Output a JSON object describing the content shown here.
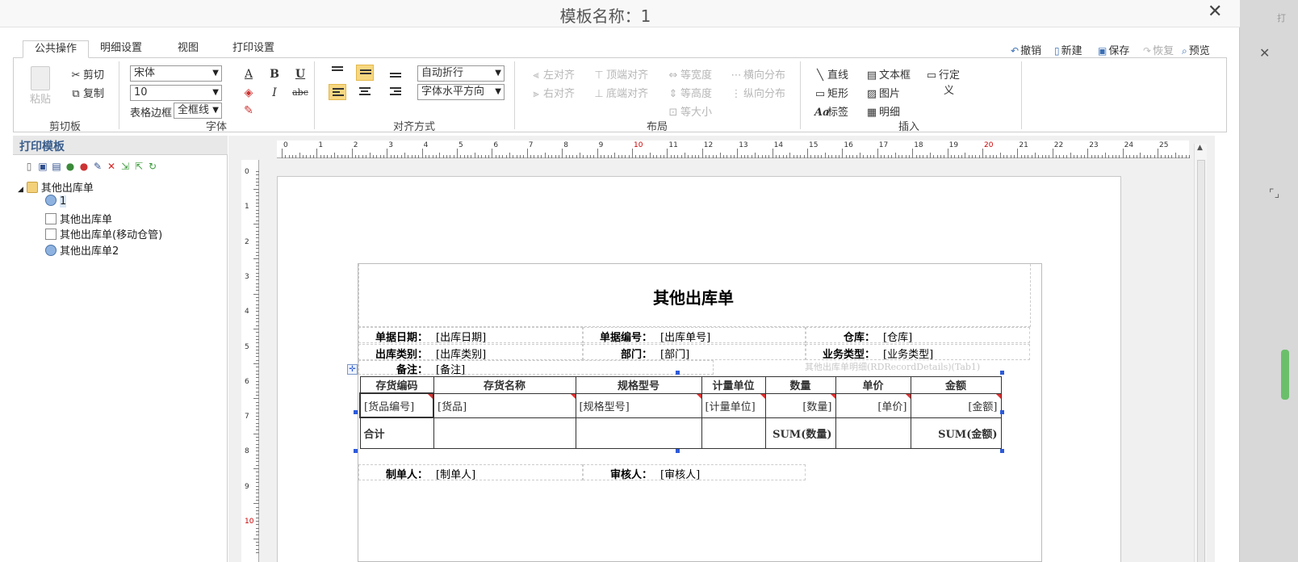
{
  "window": {
    "title": "模板名称：1",
    "close": "✕"
  },
  "tabs": [
    {
      "label": "公共操作",
      "active": true
    },
    {
      "label": "明细设置",
      "active": false
    },
    {
      "label": "视图",
      "active": false
    },
    {
      "label": "打印设置",
      "active": false
    }
  ],
  "quick_actions": {
    "undo": "撤销",
    "new": "新建",
    "save": "保存",
    "redo": "恢复",
    "preview": "预览"
  },
  "ribbon": {
    "clipboard": {
      "group": "剪切板",
      "paste": "粘贴",
      "cut": "剪切",
      "copy": "复制"
    },
    "font": {
      "group": "字体",
      "family": "宋体",
      "size": "10",
      "border_label": "表格边框",
      "border_value": "全框线",
      "bold": "B",
      "italic": "I",
      "underline": "U",
      "strike": "abc"
    },
    "align": {
      "group": "对齐方式",
      "wrap": "自动折行",
      "direction": "字体水平方向"
    },
    "layout": {
      "group": "布局",
      "left": "左对齐",
      "right": "右对齐",
      "top": "顶端对齐",
      "bottom": "底端对齐",
      "same_width": "等宽度",
      "same_height": "等高度",
      "same_size": "等大小",
      "h_dist": "横向分布",
      "v_dist": "纵向分布"
    },
    "insert": {
      "group": "插入",
      "line": "直线",
      "rect": "矩形",
      "label": "标签",
      "textbox": "文本框",
      "image": "图片",
      "detail": "明细",
      "custom_line": "行定",
      "custom_line_2": "义"
    }
  },
  "left_panel": {
    "title": "打印模板",
    "tree": {
      "root": "其他出库单",
      "selected": "1",
      "items": [
        "其他出库单",
        "其他出库单(移动仓管)",
        "其他出库单2"
      ]
    }
  },
  "ruler": {
    "top": [
      "0",
      "1",
      "2",
      "3",
      "4",
      "5",
      "6",
      "7",
      "8",
      "9",
      "10",
      "11",
      "12",
      "13",
      "14",
      "15",
      "16",
      "17",
      "18",
      "19",
      "20",
      "21",
      "22",
      "23",
      "24",
      "25"
    ],
    "left": [
      "0",
      "1",
      "2",
      "3",
      "4",
      "5",
      "6",
      "7",
      "8",
      "9",
      "10"
    ]
  },
  "report": {
    "title": "其他出库单",
    "fields": {
      "date_label": "单据日期：",
      "date_value": "[出库日期]",
      "no_label": "单据编号：",
      "no_value": "[出库单号]",
      "wh_label": "仓库：",
      "wh_value": "[仓库]",
      "type_label": "出库类别：",
      "type_value": "[出库类别]",
      "dept_label": "部门：",
      "dept_value": "[部门]",
      "biz_label": "业务类型：",
      "biz_value": "[业务类型]",
      "memo_label": "备注：",
      "memo_value": "[备注]"
    },
    "grid_caption": "其他出库单明细(RDRecordDetails)(Tab1)",
    "columns": [
      "存货编码",
      "存货名称",
      "规格型号",
      "计量单位",
      "数量",
      "单价",
      "金额"
    ],
    "row": [
      "[货品编号]",
      "[货品]",
      "[规格型号]",
      "[计量单位]",
      "[数量]",
      "[单价]",
      "[金额]"
    ],
    "sum_row": [
      "合计",
      "",
      "",
      "",
      "SUM(数量)",
      "",
      "SUM(金额)"
    ],
    "footer": {
      "maker_label": "制单人：",
      "maker_value": "[制单人]",
      "checker_label": "审核人：",
      "checker_value": "[审核人]"
    }
  }
}
